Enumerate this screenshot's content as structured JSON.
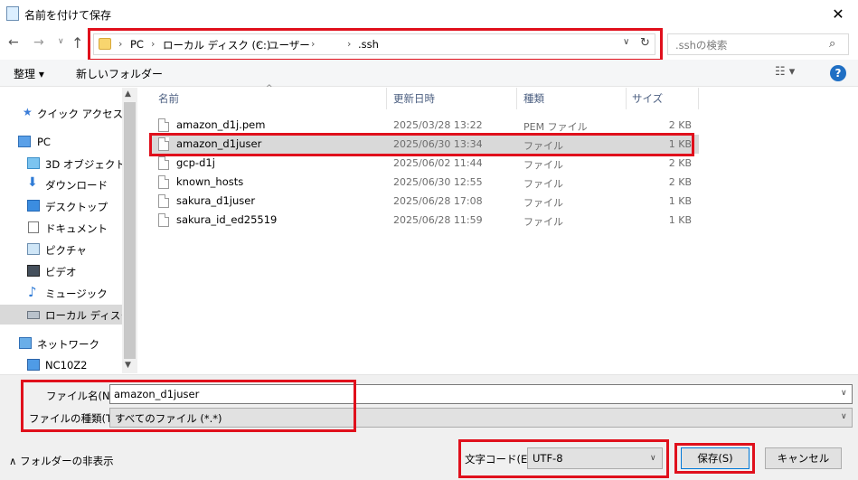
{
  "window": {
    "title": "名前を付けて保存",
    "close_glyph": "✕"
  },
  "nav": {
    "back": "←",
    "forward": "→",
    "recent": "∨",
    "up": "↑",
    "breadcrumb": [
      "PC",
      "ローカル ディスク (C:)",
      "ユーザー",
      ".ssh"
    ],
    "breadcrumb_sep": "›",
    "dropdown": "∨",
    "refresh": "↻",
    "search_placeholder": ".sshの検索",
    "search_icon": "⌕"
  },
  "toolbar": {
    "organize": "整理 ▾",
    "new_folder": "新しいフォルダー",
    "view": "☷ ▾",
    "help": "?"
  },
  "sidebar": {
    "items": [
      {
        "label": "クイック アクセス",
        "icon": "star-icon"
      },
      {
        "label": "PC",
        "icon": "computer-icon"
      },
      {
        "label": "3D オブジェクト",
        "icon": "cube-icon"
      },
      {
        "label": "ダウンロード",
        "icon": "download-icon"
      },
      {
        "label": "デスクトップ",
        "icon": "desktop-icon"
      },
      {
        "label": "ドキュメント",
        "icon": "document-icon"
      },
      {
        "label": "ピクチャ",
        "icon": "picture-icon"
      },
      {
        "label": "ビデオ",
        "icon": "video-icon"
      },
      {
        "label": "ミュージック",
        "icon": "music-icon"
      },
      {
        "label": "ローカル ディスク (C",
        "icon": "drive-icon"
      },
      {
        "label": "ネットワーク",
        "icon": "network-icon"
      },
      {
        "label": "NC10Z2",
        "icon": "monitor-icon"
      }
    ]
  },
  "files": {
    "columns": [
      "名前",
      "更新日時",
      "種類",
      "サイズ"
    ],
    "rows": [
      {
        "name": "amazon_d1j.pem",
        "date": "2025/03/28 13:22",
        "type": "PEM ファイル",
        "size": "2 KB"
      },
      {
        "name": "amazon_d1juser",
        "date": "2025/06/30 13:34",
        "type": "ファイル",
        "size": "1 KB"
      },
      {
        "name": "gcp-d1j",
        "date": "2025/06/02 11:44",
        "type": "ファイル",
        "size": "2 KB"
      },
      {
        "name": "known_hosts",
        "date": "2025/06/30 12:55",
        "type": "ファイル",
        "size": "2 KB"
      },
      {
        "name": "sakura_d1juser",
        "date": "2025/06/28 17:08",
        "type": "ファイル",
        "size": "1 KB"
      },
      {
        "name": "sakura_id_ed25519",
        "date": "2025/06/28 11:59",
        "type": "ファイル",
        "size": "1 KB"
      }
    ]
  },
  "form": {
    "filename_label": "ファイル名(N):",
    "filename_value": "amazon_d1juser",
    "filetype_label": "ファイルの種類(T):",
    "filetype_value": "すべてのファイル (*.*)",
    "hide_folders": "フォルダーの非表示",
    "encoding_label": "文字コード(E):",
    "encoding_value": "UTF-8",
    "save": "保存(S)",
    "cancel": "キャンセル"
  },
  "colors": {
    "highlight": "#e0101c",
    "selection": "#d9d9d9",
    "help_blue": "#1f6fc4"
  }
}
